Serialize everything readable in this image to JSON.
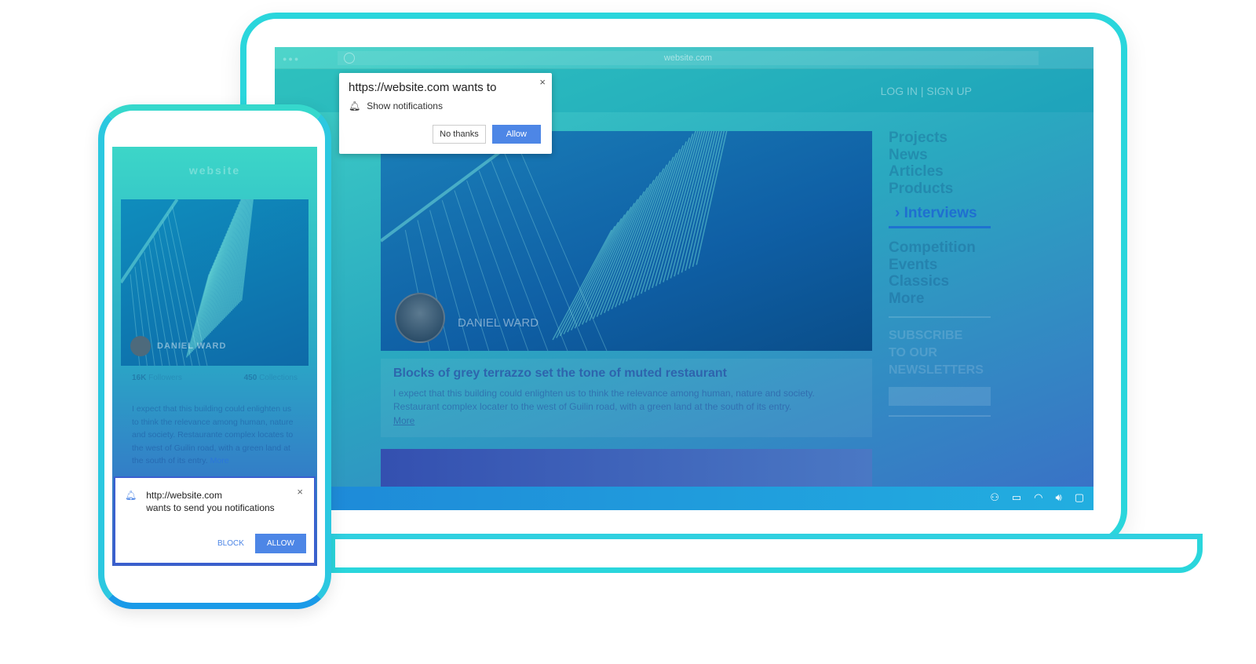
{
  "laptop": {
    "url": "website.com",
    "auth": "LOG IN | SIGN UP",
    "hero_name": "DANIEL WARD",
    "article": {
      "title": "Blocks of grey terrazzo set the tone of muted restaurant",
      "body": "I expect that this building could enlighten us to think the relevance among human, nature and society. Restaurant complex locater to the west of Guilin road, with a green land at the south of its entry.",
      "more": "More"
    },
    "nav": {
      "items_top": [
        "Projects",
        "News",
        "Articles",
        "Products"
      ],
      "active": "Interviews",
      "items_bottom": [
        "Competition",
        "Events",
        "Classics",
        "More"
      ],
      "subscribe": [
        "SUBSCRIBE",
        "TO OUR",
        "NEWSLETTERS"
      ]
    },
    "tray_icons": [
      "people-icon",
      "battery-icon",
      "wifi-icon",
      "volume-icon",
      "message-icon"
    ]
  },
  "desktop_prompt": {
    "title": "https://website.com wants to",
    "permission": "Show notifications",
    "deny": "No thanks",
    "allow": "Allow",
    "close": "×"
  },
  "phone": {
    "title": "website",
    "hero_name": "DANIEL WARD",
    "stats": [
      {
        "value": "16K",
        "label": "Followers"
      },
      {
        "value": "450",
        "label": "Collections"
      }
    ],
    "body": "I expect that this building could enlighten us to think the relevance among human, nature and society. Restaurante complex locates to the west of Guilin road, with a green land at the south of its entry.",
    "more": "More"
  },
  "mobile_prompt": {
    "origin": "http://website.com",
    "message": "wants to send you notifications",
    "block": "BLOCK",
    "allow": "ALLOW",
    "close": "×"
  },
  "colors": {
    "frame": "#2ad6dc",
    "accent": "#4d86e6",
    "active_nav": "#1f6fd0"
  }
}
